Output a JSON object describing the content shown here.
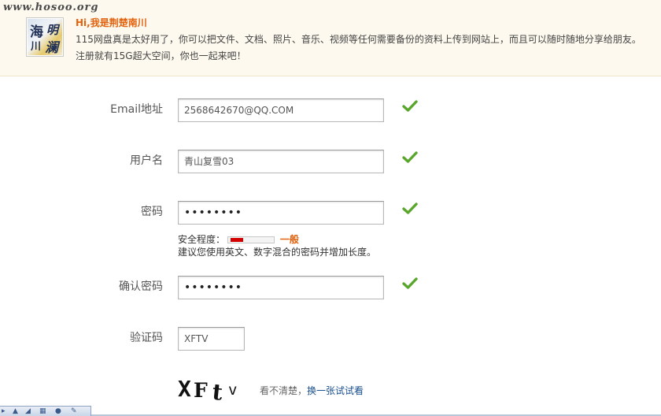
{
  "watermark": "www.hosoo.org",
  "header": {
    "greeting": "Hi,我是荆楚南川",
    "intro_line1": "115网盘真是太好用了，你可以把文件、文档、照片、音乐、视频等任何需要备份的资料上传到网站上，而且可以随时随地分享给朋友。",
    "intro_line2": "注册就有15G超大空间，你也一起来吧！",
    "avatar_text": [
      "海",
      "明",
      "川",
      "澜"
    ]
  },
  "form": {
    "email": {
      "label": "Email地址",
      "value": "2568642670@QQ.COM",
      "valid": true
    },
    "username": {
      "label": "用户名",
      "value": "青山复雪03",
      "valid": true
    },
    "password": {
      "label": "密码",
      "value": "••••••••",
      "valid": true
    },
    "strength": {
      "prefix": "安全程度：",
      "level": "一般",
      "level_fraction": 0.3,
      "hint": "建议您使用英文、数字混合的密码并增加长度。"
    },
    "confirm": {
      "label": "确认密码",
      "value": "••••••••",
      "valid": true
    },
    "captcha": {
      "label": "验证码",
      "value": "XFTV",
      "image_text": "XFtv",
      "unclear": "看不清楚，",
      "refresh": "换一张试试看"
    }
  },
  "colors": {
    "accent_orange": "#e2620e",
    "check_green": "#5aa52b",
    "link_blue": "#1a4f8e"
  },
  "icons": [
    "check-icon",
    "taskbar-icons"
  ]
}
